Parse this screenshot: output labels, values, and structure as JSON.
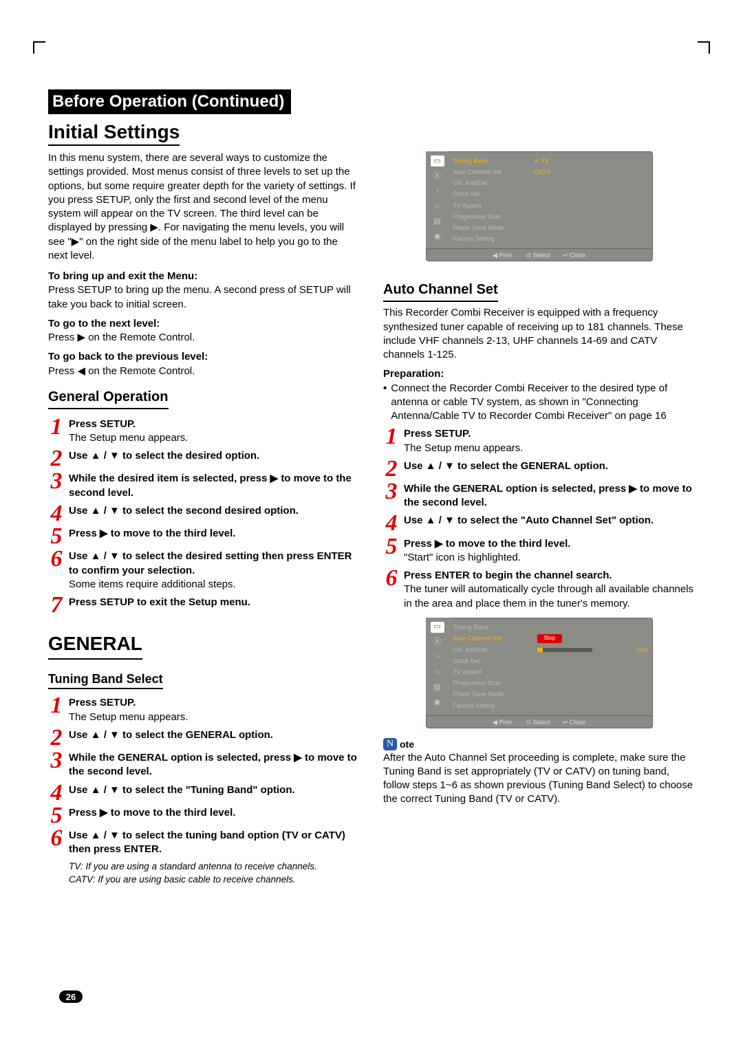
{
  "section_title": "Before Operation (Continued)",
  "page_title": "Initial Settings",
  "intro": "In this menu system, there are several ways to customize the settings provided. Most menus consist of three levels to set up the options, but some require greater depth for the variety of settings. If you press SETUP, only the first and second level of the menu system will appear on the TV screen. The third level can be displayed by pressing ▶. For navigating the menu levels, you will see \"▶\" on the right side of the menu label to help you go to the next level.",
  "bring_up_h": "To bring up and exit the Menu:",
  "bring_up_t": "Press SETUP to bring up the menu. A second press of SETUP will take you back to initial screen.",
  "next_h": "To go to the next level:",
  "next_t": "Press ▶ on the Remote Control.",
  "prev_h": "To go back to the previous level:",
  "prev_t": "Press ◀ on the Remote Control.",
  "genop_h": "General Operation",
  "genop_steps": [
    {
      "b": "Press SETUP.",
      "t": "The Setup menu appears."
    },
    {
      "b": "Use ▲ / ▼ to select the desired option."
    },
    {
      "b": "While the desired item is selected, press ▶ to move to the second level."
    },
    {
      "b": "Use ▲ / ▼ to select the second desired option."
    },
    {
      "b": "Press ▶ to move to the third level."
    },
    {
      "b": "Use ▲ / ▼ to select the desired setting then press ENTER to confirm your selection.",
      "t": "Some items require additional steps."
    },
    {
      "b": "Press SETUP to exit the Setup menu."
    }
  ],
  "general_h": "GENERAL",
  "tuning_h": "Tuning Band Select",
  "tuning_steps": [
    {
      "b": "Press SETUP.",
      "t": "The Setup menu appears."
    },
    {
      "b": "Use ▲ / ▼ to select the GENERAL option."
    },
    {
      "b": "While the GENERAL option is selected, press ▶ to move to the second level."
    },
    {
      "b": "Use ▲ / ▼ to select the \"Tuning Band\" option."
    },
    {
      "b": "Press ▶ to move to the third level."
    },
    {
      "b": "Use ▲ / ▼ to select the tuning band option (TV or CATV) then press ENTER."
    }
  ],
  "tuning_note1": "TV: If you are using a standard antenna to receive channels.",
  "tuning_note2": "CATV: If you are using basic cable to receive channels.",
  "osd1": {
    "items": [
      "Tuning Band",
      "Auto Channel Set",
      "CH. Add/Del",
      "Clock Set",
      "TV Aspect",
      "Progressive Scan",
      "Power Save Mode",
      "Factory Setting"
    ],
    "hl": 0,
    "val_tv": "TV",
    "val_catv": "CATV",
    "foot_prev": "◀ Prev.",
    "foot_sel": "⊙ Select",
    "foot_close": "↩ Close"
  },
  "auto_h": "Auto Channel Set",
  "auto_intro1": "This Recorder Combi Receiver is equipped with a frequency",
  "auto_intro2": "synthesized tuner capable of receiving up to 181 channels. These include VHF channels 2-13, UHF channels 14-69 and CATV channels 1-125.",
  "prep_h": "Preparation:",
  "prep_t": "Connect the Recorder Combi Receiver to the desired type of antenna or cable TV system, as shown in \"Connecting Antenna/Cable TV to Recorder Combi Receiver\" on page 16",
  "auto_steps": [
    {
      "b": "Press SETUP.",
      "t": "The Setup menu appears."
    },
    {
      "b": "Use ▲ / ▼ to select the GENERAL option."
    },
    {
      "b": "While the GENERAL option is selected, press ▶ to move to the second level."
    },
    {
      "b": "Use ▲ / ▼ to select the \"Auto Channel Set\" option."
    },
    {
      "b": "Press ▶ to move to the third level.",
      "t": "\"Start\" icon is highlighted."
    },
    {
      "b": "Press ENTER to begin the channel search.",
      "t": "The tuner will automatically cycle through all available channels in the area and place them in the tuner's memory."
    }
  ],
  "osd2": {
    "items": [
      "Tuning Band",
      "Auto Channel Set",
      "CH. Add/Del",
      "Clock Set",
      "TV Aspect",
      "Progressive Scan",
      "Power Save Mode",
      "Factory Setting"
    ],
    "hl": 1,
    "stop": "Stop",
    "pct": "11%",
    "foot_prev": "◀ Prev.",
    "foot_sel": "⊙ Select",
    "foot_close": "↩ Close"
  },
  "note_letter": "N",
  "note_h": "ote",
  "note_t": "After the Auto Channel Set proceeding is complete, make sure the Tuning Band is set appropriately (TV or CATV) on tuning band, follow steps 1~6 as shown previous (Tuning Band Select) to choose the correct Tuning Band (TV or CATV).",
  "page_number": "26"
}
